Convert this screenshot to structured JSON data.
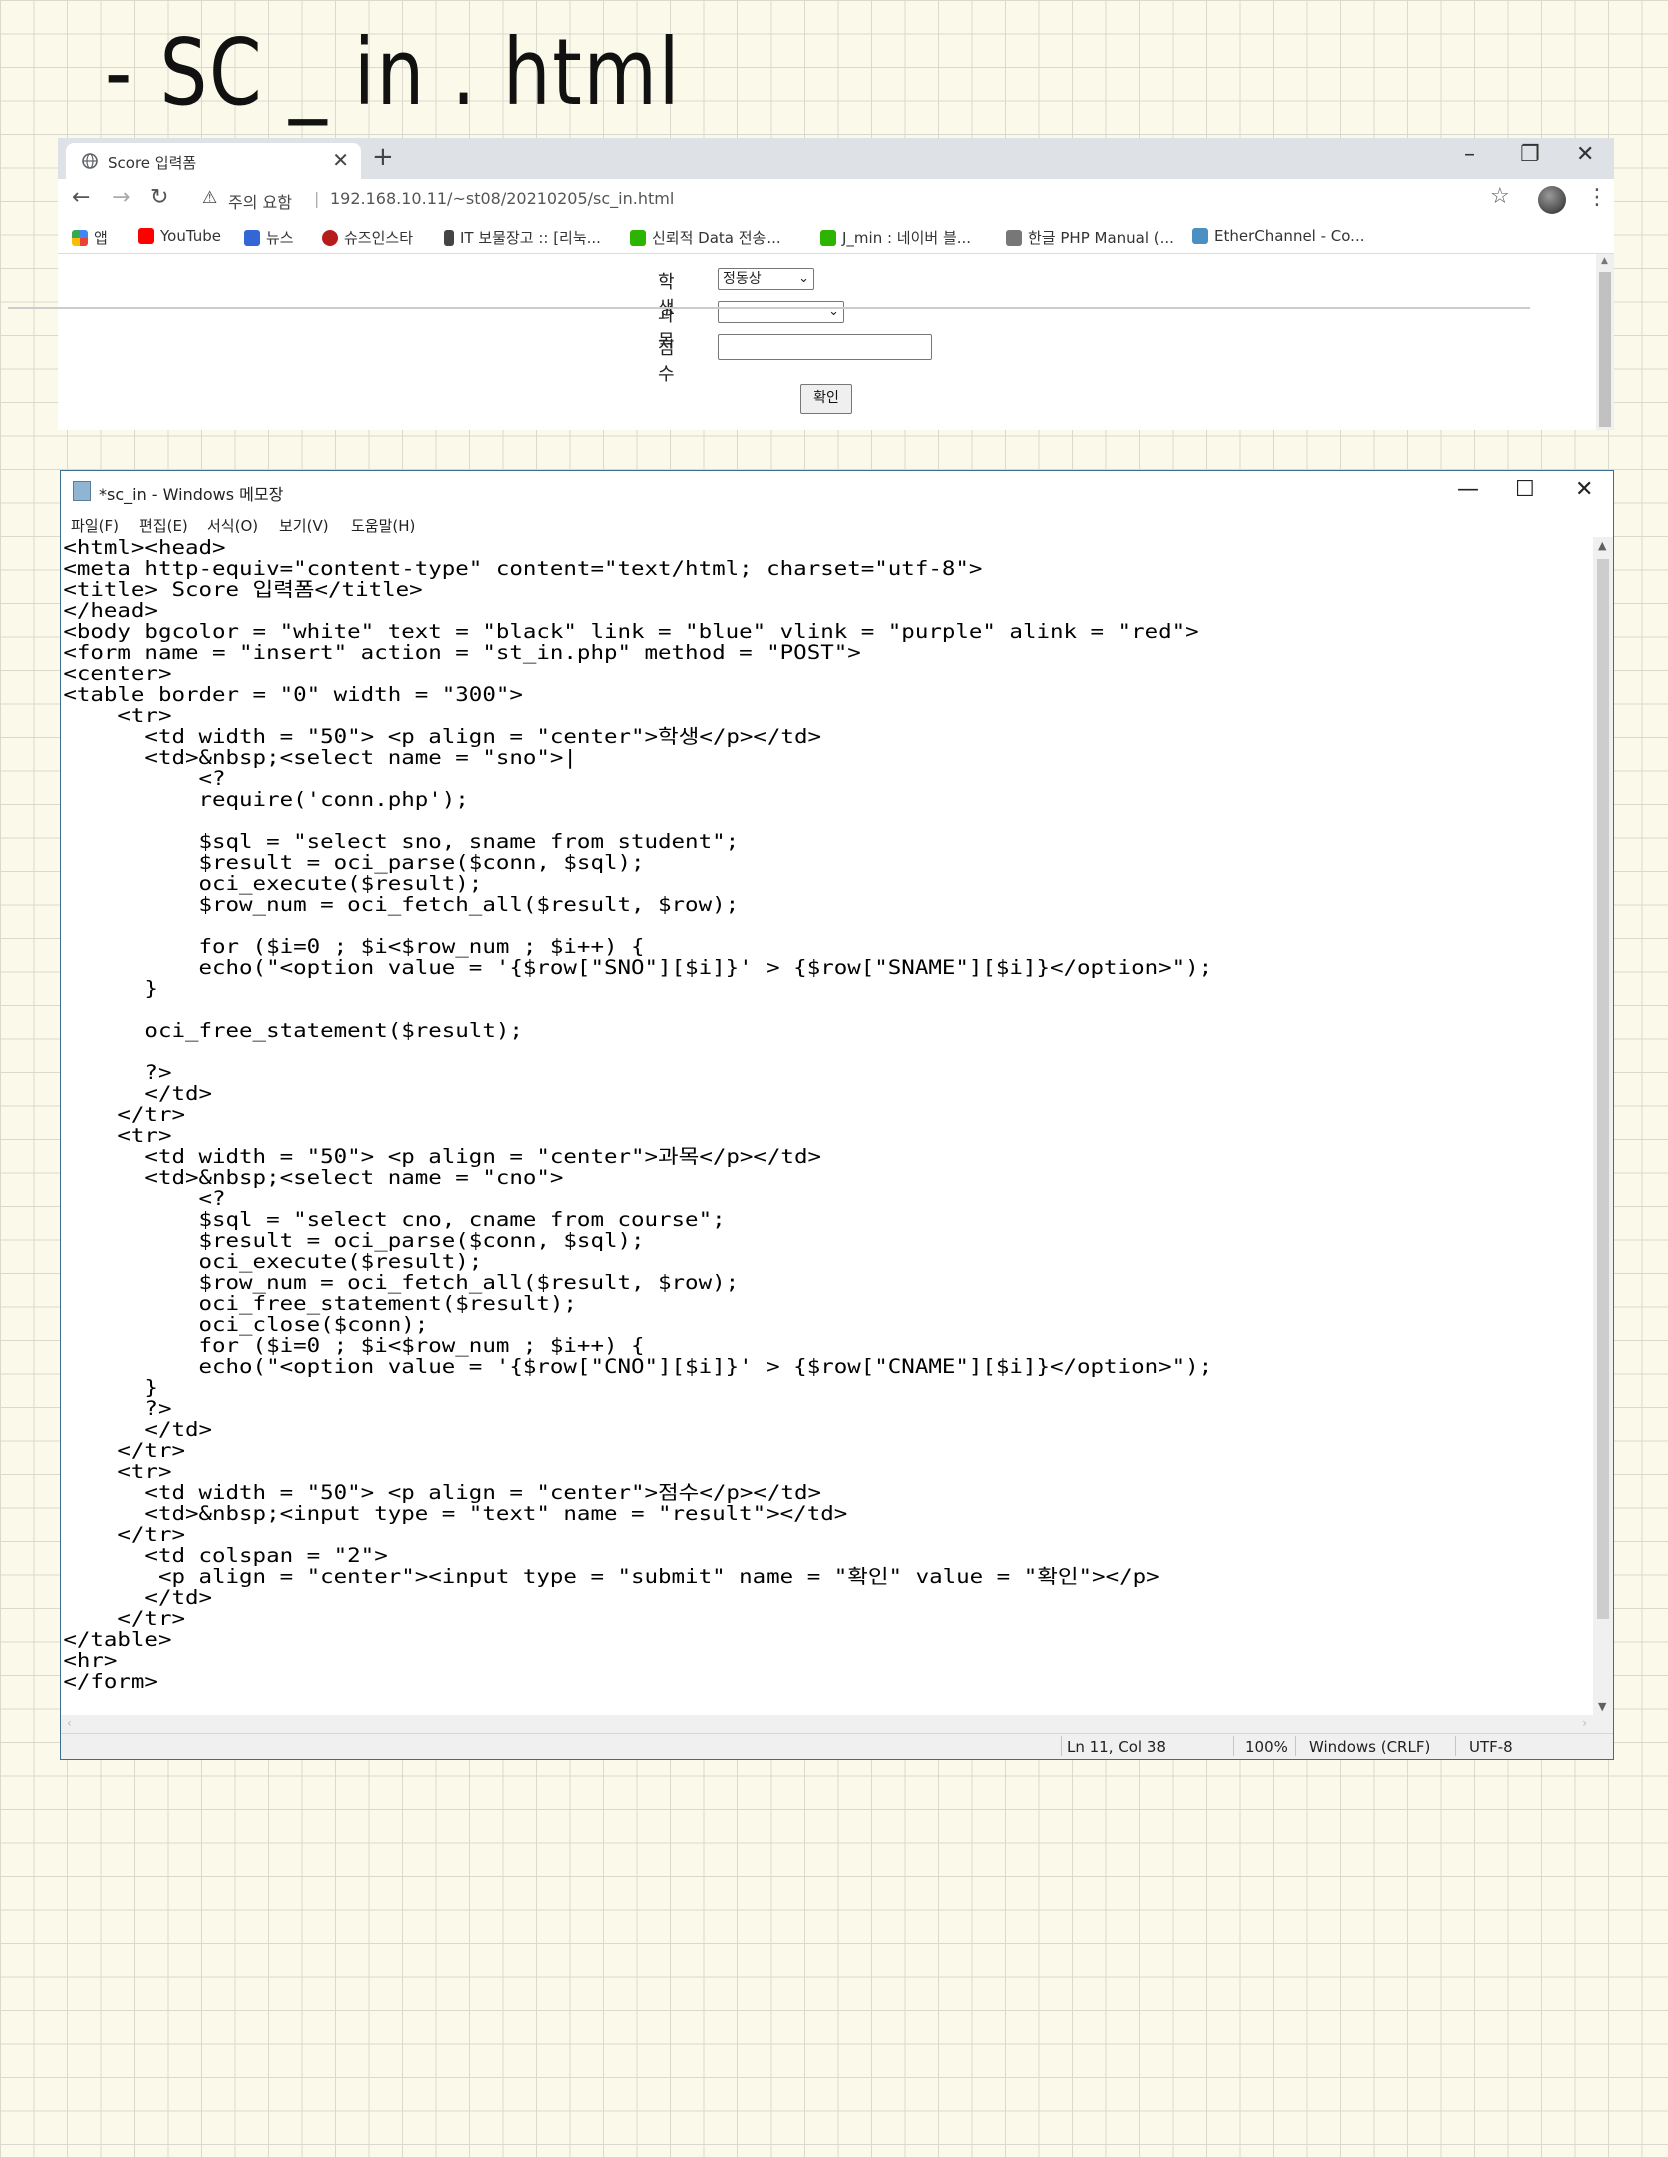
{
  "handwritten_title": "- SC _ in . html",
  "browser": {
    "tab_title": "Score 입력폼",
    "tab_close": "✕",
    "new_tab": "+",
    "window_controls": [
      "–",
      "❐",
      "✕"
    ],
    "nav": {
      "back": "←",
      "forward": "→",
      "reload": "↻"
    },
    "security_warning": "주의 요함",
    "url": "192.168.10.11/~st08/20210205/sc_in.html",
    "bookmarks": [
      {
        "label": "앱",
        "color": "#4285f4"
      },
      {
        "label": "YouTube",
        "color": "#ff0000"
      },
      {
        "label": "뉴스",
        "color": "#3367d6"
      },
      {
        "label": "슈즈인스타",
        "color": "#b71c1c"
      },
      {
        "label": "IT 보물장고 :: [리눅...",
        "color": "#444444"
      },
      {
        "label": "신뢰적 Data 전송...",
        "color": "#2db400"
      },
      {
        "label": "J_min : 네이버 블...",
        "color": "#2db400"
      },
      {
        "label": "한글 PHP Manual (...",
        "color": "#777777"
      },
      {
        "label": "EtherChannel - Co...",
        "color": "#4a90c2"
      }
    ],
    "form": {
      "student_label": "학생",
      "student_selected": "정동상",
      "course_label": "과목",
      "course_selected": "",
      "score_label": "점수",
      "score_value": "",
      "submit_label": "확인"
    }
  },
  "notepad": {
    "title": "*sc_in - Windows 메모장",
    "window_controls": [
      "—",
      "☐",
      "✕"
    ],
    "menu": [
      "파일(F)",
      "편집(E)",
      "서식(O)",
      "보기(V)",
      "도움말(H)"
    ],
    "code": "<html><head>\n<meta http-equiv=\"content-type\" content=\"text/html; charset=\"utf-8\">\n<title> Score 입력폼</title>\n</head>\n<body bgcolor = \"white\" text = \"black\" link = \"blue\" vlink = \"purple\" alink = \"red\">\n<form name = \"insert\" action = \"st_in.php\" method = \"POST\">\n<center>\n<table border = \"0\" width = \"300\">\n    <tr>\n      <td width = \"50\"> <p align = \"center\">학생</p></td>\n      <td>&nbsp;<select name = \"sno\">|\n          <?\n          require('conn.php');\n\n          $sql = \"select sno, sname from student\";\n          $result = oci_parse($conn, $sql);\n          oci_execute($result);\n          $row_num = oci_fetch_all($result, $row);\n\n          for ($i=0 ; $i<$row_num ; $i++) {\n          echo(\"<option value = '{$row[\"SNO\"][$i]}' > {$row[\"SNAME\"][$i]}</option>\");\n      }\n\n      oci_free_statement($result);\n\n      ?>\n      </td>\n    </tr>\n    <tr>\n      <td width = \"50\"> <p align = \"center\">과목</p></td>\n      <td>&nbsp;<select name = \"cno\">\n          <?\n          $sql = \"select cno, cname from course\";\n          $result = oci_parse($conn, $sql);\n          oci_execute($result);\n          $row_num = oci_fetch_all($result, $row);\n          oci_free_statement($result);\n          oci_close($conn);\n          for ($i=0 ; $i<$row_num ; $i++) {\n          echo(\"<option value = '{$row[\"CNO\"][$i]}' > {$row[\"CNAME\"][$i]}</option>\");\n      }\n      ?>\n      </td>\n    </tr>\n    <tr>\n      <td width = \"50\"> <p align = \"center\">점수</p></td>\n      <td>&nbsp;<input type = \"text\" name = \"result\"></td>\n    </tr>\n      <td colspan = \"2\">\n       <p align = \"center\"><input type = \"submit\" name = \"확인\" value = \"확인\"></p>\n      </td>\n    </tr>\n</table>\n<hr>\n</form>",
    "status": {
      "position": "Ln 11, Col 38",
      "zoom": "100%",
      "line_ending": "Windows (CRLF)",
      "encoding": "UTF-8"
    }
  }
}
